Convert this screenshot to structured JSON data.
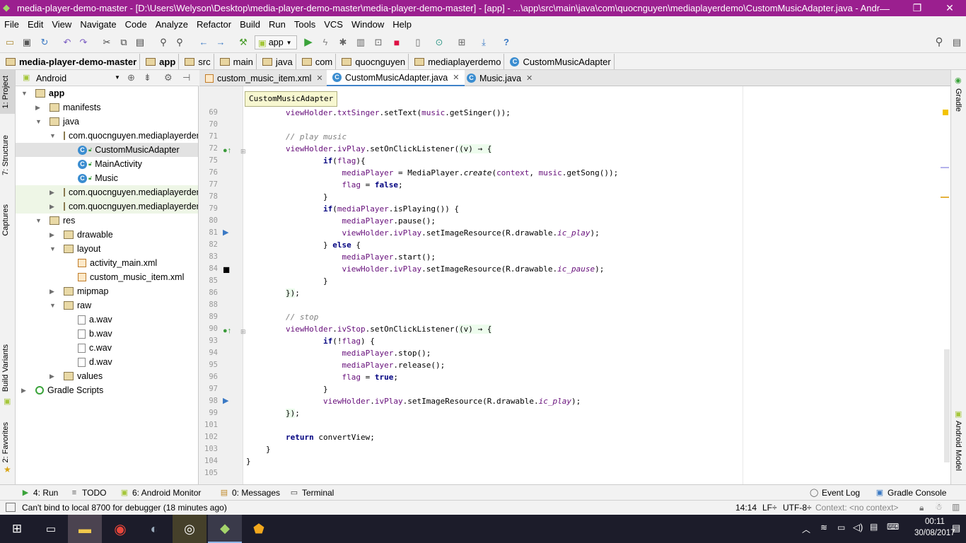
{
  "window": {
    "title": "media-player-demo-master - [D:\\Users\\Welyson\\Desktop\\media-player-demo-master\\media-player-demo-master] - [app] - ...\\app\\src\\main\\java\\com\\quocnguyen\\mediaplayerdemo\\CustomMusicAdapter.java - Android St...",
    "minimize": "—",
    "restore": "❐",
    "close": "✕"
  },
  "menu": [
    "File",
    "Edit",
    "View",
    "Navigate",
    "Code",
    "Analyze",
    "Refactor",
    "Build",
    "Run",
    "Tools",
    "VCS",
    "Window",
    "Help"
  ],
  "toolbar": {
    "run_config": "app"
  },
  "breadcrumbs": [
    "media-player-demo-master",
    "app",
    "src",
    "main",
    "java",
    "com",
    "quocnguyen",
    "mediaplayerdemo",
    "CustomMusicAdapter"
  ],
  "left_tabs": [
    "1: Project",
    "7: Structure",
    "Captures",
    "Build Variants",
    "2: Favorites"
  ],
  "right_tabs": [
    "Gradle",
    "Android Model"
  ],
  "project": {
    "view_selector": "Android",
    "tree": [
      {
        "label": "app",
        "depth": 0,
        "type": "module",
        "open": true
      },
      {
        "label": "manifests",
        "depth": 1,
        "type": "folder",
        "open": false
      },
      {
        "label": "java",
        "depth": 1,
        "type": "folder",
        "open": true
      },
      {
        "label": "com.quocnguyen.mediaplayerdemo",
        "depth": 2,
        "type": "package",
        "open": true
      },
      {
        "label": "CustomMusicAdapter",
        "depth": 3,
        "type": "class",
        "selected": true
      },
      {
        "label": "MainActivity",
        "depth": 3,
        "type": "class"
      },
      {
        "label": "Music",
        "depth": 3,
        "type": "class"
      },
      {
        "label": "com.quocnguyen.mediaplayerdemo",
        "depth": 2,
        "type": "package",
        "open": false,
        "tint": true
      },
      {
        "label": "com.quocnguyen.mediaplayerdemo",
        "depth": 2,
        "type": "package",
        "open": false,
        "tint": true
      },
      {
        "label": "res",
        "depth": 1,
        "type": "folder",
        "open": true
      },
      {
        "label": "drawable",
        "depth": 2,
        "type": "folder",
        "open": false
      },
      {
        "label": "layout",
        "depth": 2,
        "type": "folder",
        "open": true
      },
      {
        "label": "activity_main.xml",
        "depth": 3,
        "type": "xml"
      },
      {
        "label": "custom_music_item.xml",
        "depth": 3,
        "type": "xml"
      },
      {
        "label": "mipmap",
        "depth": 2,
        "type": "folder",
        "open": false
      },
      {
        "label": "raw",
        "depth": 2,
        "type": "folder",
        "open": true
      },
      {
        "label": "a.wav",
        "depth": 3,
        "type": "file"
      },
      {
        "label": "b.wav",
        "depth": 3,
        "type": "file"
      },
      {
        "label": "c.wav",
        "depth": 3,
        "type": "file"
      },
      {
        "label": "d.wav",
        "depth": 3,
        "type": "file"
      },
      {
        "label": "values",
        "depth": 2,
        "type": "folder",
        "open": false
      },
      {
        "label": "Gradle Scripts",
        "depth": 0,
        "type": "gradle",
        "open": false
      }
    ]
  },
  "editor_tabs": [
    {
      "label": "custom_music_item.xml",
      "active": false
    },
    {
      "label": "CustomMusicAdapter.java",
      "active": true
    },
    {
      "label": "Music.java",
      "active": false
    }
  ],
  "tooltip": "CustomMusicAdapter",
  "code_lines": [
    {
      "n": "69",
      "html": "<span class=\"fd\">viewHolder</span>.<span class=\"fd\">txtSinger</span>.setText(<span class=\"fd\">music</span>.getSinger());"
    },
    {
      "n": "70",
      "html": ""
    },
    {
      "n": "71",
      "html": "<span class=\"cm\">// play music</span>"
    },
    {
      "n": "72",
      "html": "<span class=\"fd\">viewHolder</span>.<span class=\"fd\">ivPlay</span>.setOnClickListener(<span class=\"lam\">(v) → {</span>"
    },
    {
      "n": "75",
      "html": "        <span class=\"kw\">if</span>(<span class=\"fd\">flag</span>){"
    },
    {
      "n": "76",
      "html": "            <span class=\"fd\">mediaPlayer</span> = MediaPlayer.<i>create</i>(<span class=\"fd\">context</span>, <span class=\"fd\">music</span>.getSong());"
    },
    {
      "n": "77",
      "html": "            <span class=\"fd\">flag</span> = <span class=\"kw\">false</span>;"
    },
    {
      "n": "78",
      "html": "        }"
    },
    {
      "n": "79",
      "html": "        <span class=\"kw\">if</span>(<span class=\"fd\">mediaPlayer</span>.isPlaying()) {"
    },
    {
      "n": "80",
      "html": "            <span class=\"fd\">mediaPlayer</span>.pause();"
    },
    {
      "n": "81",
      "html": "            <span class=\"fd\">viewHolder</span>.<span class=\"fd\">ivPlay</span>.setImageResource(R.drawable.<span class=\"it\">ic_play</span>);"
    },
    {
      "n": "82",
      "html": "        } <span class=\"kw\">else</span> {"
    },
    {
      "n": "83",
      "html": "            <span class=\"fd\">mediaPlayer</span>.start();"
    },
    {
      "n": "84",
      "html": "            <span class=\"fd\">viewHolder</span>.<span class=\"fd\">ivPlay</span>.setImageResource(R.drawable.<span class=\"it\">ic_pause</span>);"
    },
    {
      "n": "85",
      "html": "        }"
    },
    {
      "n": "86",
      "html": "<span class=\"lam\">})</span>;"
    },
    {
      "n": "88",
      "html": ""
    },
    {
      "n": "89",
      "html": "<span class=\"cm\">// stop</span>"
    },
    {
      "n": "90",
      "html": "<span class=\"fd\">viewHolder</span>.<span class=\"fd\">ivStop</span>.setOnClickListener(<span class=\"lam\">(v) → {</span>"
    },
    {
      "n": "93",
      "html": "        <span class=\"kw\">if</span>(!<span class=\"fd\">flag</span>) {"
    },
    {
      "n": "94",
      "html": "            <span class=\"fd\">mediaPlayer</span>.stop();"
    },
    {
      "n": "95",
      "html": "            <span class=\"fd\">mediaPlayer</span>.release();"
    },
    {
      "n": "96",
      "html": "            <span class=\"fd\">flag</span> = <span class=\"kw\">true</span>;"
    },
    {
      "n": "97",
      "html": "        }"
    },
    {
      "n": "98",
      "html": "        <span class=\"fd\">viewHolder</span>.<span class=\"fd\">ivPlay</span>.setImageResource(R.drawable.<span class=\"it\">ic_play</span>);"
    },
    {
      "n": "99",
      "html": "<span class=\"lam\">})</span>;"
    },
    {
      "n": "101",
      "html": ""
    },
    {
      "n": "102",
      "html": "<span class=\"kw\">return</span> convertView;"
    },
    {
      "n": "103",
      "html": "}"
    },
    {
      "n": "104",
      "html": "}"
    },
    {
      "n": "105",
      "html": ""
    }
  ],
  "tool_windows": {
    "run": "4: Run",
    "todo": "TODO",
    "android_monitor": "6: Android Monitor",
    "messages": "0: Messages",
    "terminal": "Terminal",
    "event_log": "Event Log",
    "gradle_console": "Gradle Console"
  },
  "status": {
    "message": "Can't bind to local 8700 for debugger (18 minutes ago)",
    "position": "14:14",
    "line_sep": "LF÷",
    "encoding": "UTF-8÷",
    "context": "Context: <no context>"
  },
  "taskbar": {
    "time": "00:11",
    "date": "30/08/2017"
  },
  "colors": {
    "title_bar": "#9b1f8f",
    "selection": "#e2e2e2",
    "accent": "#4083c9"
  }
}
